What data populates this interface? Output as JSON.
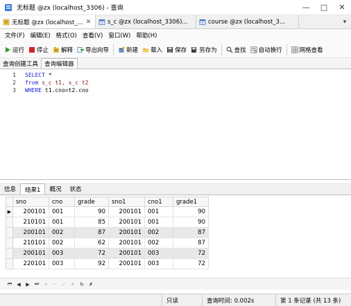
{
  "window": {
    "title": "无标题 @zx (localhost_3306) - 查询",
    "controls": [
      "minimize-icon",
      "maximize-icon",
      "close-icon"
    ]
  },
  "tabs": [
    {
      "label": "无标题 @zx (localhost_...",
      "icon": "query-icon",
      "active": true
    },
    {
      "label": "s_c @zx (localhost_3306)...",
      "icon": "table-icon",
      "active": false
    },
    {
      "label": "course @zx (localhost_3...",
      "icon": "table-icon",
      "active": false
    }
  ],
  "menu": [
    "文件(F)",
    "编辑(E)",
    "格式(O)",
    "查看(V)",
    "窗口(W)",
    "帮助(H)"
  ],
  "toolbar": {
    "run": "运行",
    "stop": "停止",
    "explain": "解释",
    "export": "导出向导",
    "new": "新建",
    "load": "载入",
    "save": "保存",
    "save_as": "另存为",
    "find": "查找",
    "word_wrap": "自动换行",
    "grid_view": "网格查看"
  },
  "subtabs": [
    "查询创建工具",
    "查询编辑器"
  ],
  "editor": {
    "lines": [
      {
        "n": "1",
        "kw": "SELECT",
        "rest": " *"
      },
      {
        "n": "2",
        "kw": "from",
        "rest": " s_c t1, s_c t2"
      },
      {
        "n": "3",
        "kw": "WHERE",
        "rest": " t1.cno=t2.cno"
      }
    ]
  },
  "result_tabs": [
    "信息",
    "结果1",
    "概况",
    "状态"
  ],
  "result": {
    "columns": [
      "sno",
      "cno",
      "grade",
      "sno1",
      "cno1",
      "grade1"
    ],
    "rows": [
      [
        "200101",
        "001",
        "90",
        "200101",
        "001",
        "90"
      ],
      [
        "210101",
        "001",
        "85",
        "200101",
        "001",
        "90"
      ],
      [
        "200101",
        "002",
        "87",
        "200101",
        "002",
        "87"
      ],
      [
        "210101",
        "002",
        "62",
        "200101",
        "002",
        "87"
      ],
      [
        "200101",
        "003",
        "72",
        "200101",
        "003",
        "72"
      ],
      [
        "220101",
        "003",
        "92",
        "200101",
        "003",
        "72"
      ]
    ],
    "current_row_indicator": "▶"
  },
  "navigator": [
    "first-record-icon",
    "prev-record-icon",
    "next-record-icon",
    "last-record-icon",
    "add-record-icon",
    "delete-record-icon",
    "apply-icon",
    "discard-icon",
    "refresh-icon",
    "stop-icon"
  ],
  "status": {
    "mode": "只读",
    "query_time": "查询时间: 0.002s",
    "records": "第 1 条记录 (共 13 条)"
  }
}
